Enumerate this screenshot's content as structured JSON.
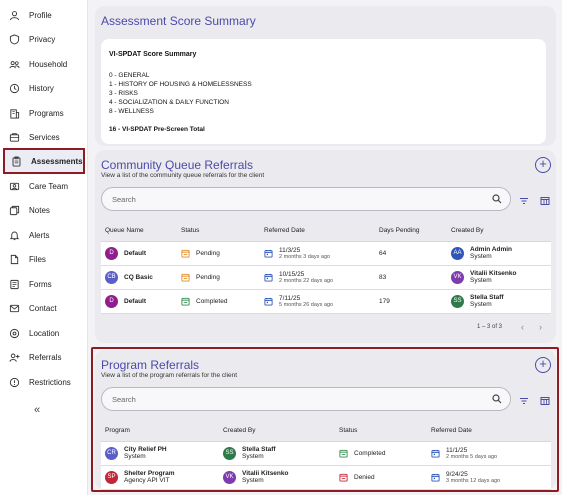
{
  "sidebar": {
    "items": [
      {
        "label": "Profile",
        "icon": "person-icon"
      },
      {
        "label": "Privacy",
        "icon": "shield-icon"
      },
      {
        "label": "Household",
        "icon": "group-icon"
      },
      {
        "label": "History",
        "icon": "history-icon"
      },
      {
        "label": "Programs",
        "icon": "building-icon"
      },
      {
        "label": "Services",
        "icon": "services-icon"
      },
      {
        "label": "Assessments",
        "icon": "clipboard-icon",
        "active": true
      },
      {
        "label": "Care Team",
        "icon": "care-team-icon"
      },
      {
        "label": "Notes",
        "icon": "notes-icon"
      },
      {
        "label": "Alerts",
        "icon": "bell-icon"
      },
      {
        "label": "Files",
        "icon": "file-icon"
      },
      {
        "label": "Forms",
        "icon": "forms-icon"
      },
      {
        "label": "Contact",
        "icon": "contact-icon"
      },
      {
        "label": "Location",
        "icon": "location-icon"
      },
      {
        "label": "Referrals",
        "icon": "referral-icon"
      },
      {
        "label": "Restrictions",
        "icon": "restriction-icon"
      }
    ],
    "collapse_label": "«"
  },
  "assessment": {
    "title": "Assessment Score Summary",
    "box_title": "VI-SPDAT Score Summary",
    "lines": [
      "0 - GENERAL",
      "1 - HISTORY OF HOUSING & HOMELESSNESS",
      "3 - RISKS",
      "4 - SOCIALIZATION & DAILY FUNCTION",
      "8 - WELLNESS"
    ],
    "total": "16 - VI-SPDAT Pre-Screen Total"
  },
  "community": {
    "title": "Community Queue Referrals",
    "subtitle": "View a list of the community queue referrals for the client",
    "search_placeholder": "Search",
    "columns": [
      "Queue Name",
      "Status",
      "Referred Date",
      "Days Pending",
      "Created By"
    ],
    "rows": [
      {
        "initials": "D",
        "avatar_color": "#8e1f8c",
        "name": "Default",
        "status": "Pending",
        "status_color": "#e08a1e",
        "date": "11/3/25",
        "ago": "2 months 3 days ago",
        "days": "64",
        "by_initials": "AA",
        "by_color": "#2f56b8",
        "by_name": "Admin Admin",
        "by_sub": "System"
      },
      {
        "initials": "CB",
        "avatar_color": "#5a5fc8",
        "name": "CQ Basic",
        "status": "Pending",
        "status_color": "#e08a1e",
        "date": "10/15/25",
        "ago": "2 months 22 days ago",
        "days": "83",
        "by_initials": "VK",
        "by_color": "#7d3cae",
        "by_name": "Vitalii Kitsenko",
        "by_sub": "System"
      },
      {
        "initials": "D",
        "avatar_color": "#8e1f8c",
        "name": "Default",
        "status": "Completed",
        "status_color": "#2f8a4a",
        "date": "7/11/25",
        "ago": "5 months 26 days ago",
        "days": "179",
        "by_initials": "SS",
        "by_color": "#2f7a4a",
        "by_name": "Stella Staff",
        "by_sub": "System"
      }
    ],
    "pager": "1 – 3 of 3"
  },
  "program": {
    "title": "Program Referrals",
    "subtitle": "View a list of the program referrals for the client",
    "search_placeholder": "Search",
    "columns": [
      "Program",
      "Created By",
      "Status",
      "Referred Date"
    ],
    "rows": [
      {
        "initials": "CR",
        "avatar_color": "#5a5fc8",
        "name": "City Relief PH",
        "sub": "System",
        "by_initials": "SS",
        "by_color": "#2f7a4a",
        "by_name": "Stella Staff",
        "by_sub": "System",
        "status": "Completed",
        "status_color": "#2f8a4a",
        "date": "11/1/25",
        "ago": "2 months 5 days ago"
      },
      {
        "initials": "SP",
        "avatar_color": "#c0283a",
        "name": "Shelter Program",
        "sub": "Agency API VIT",
        "by_initials": "VK",
        "by_color": "#7d3cae",
        "by_name": "Vitalii Kitsenko",
        "by_sub": "System",
        "status": "Denied",
        "status_color": "#c0283a",
        "date": "9/24/25",
        "ago": "3 months 12 days ago"
      }
    ]
  }
}
